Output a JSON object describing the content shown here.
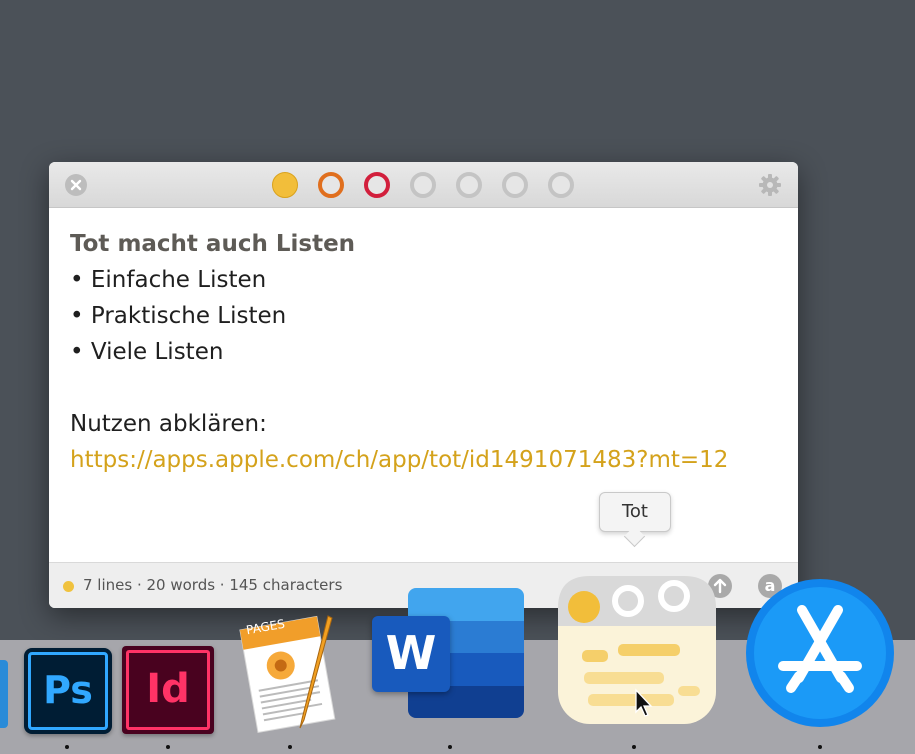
{
  "popover": {
    "title_bar": {
      "close_icon": "close-icon",
      "color_dots": [
        {
          "name": "yellow",
          "color": "#f2be3a",
          "filled": true
        },
        {
          "name": "orange",
          "color": "#e06f1e",
          "filled": false
        },
        {
          "name": "red",
          "color": "#d21f3c",
          "filled": false
        },
        {
          "name": "gray-1",
          "color": "#c4c4c4",
          "filled": false
        },
        {
          "name": "gray-2",
          "color": "#c4c4c4",
          "filled": false
        },
        {
          "name": "gray-3",
          "color": "#c4c4c4",
          "filled": false
        },
        {
          "name": "gray-4",
          "color": "#c4c4c4",
          "filled": false
        }
      ],
      "settings_icon": "gear-icon"
    },
    "note": {
      "title": "Tot macht auch Listen",
      "bullets": [
        "• Einfache Listen",
        "• Praktische Listen",
        "• Viele Listen"
      ],
      "body_label": "Nutzen abklären:",
      "link": "https://apps.apple.com/ch/app/tot/id1491071483?mt=12"
    },
    "status": {
      "dot_color": "#f0c23e",
      "text": "7 lines · 20 words · 145 characters",
      "share_icon": "share-up-arrow-icon",
      "format_icon": "at-sign-icon"
    }
  },
  "tooltip": {
    "text": "Tot"
  },
  "dock": {
    "apps": [
      {
        "name": "Photoshop",
        "label": "Ps"
      },
      {
        "name": "InDesign",
        "label": "Id"
      },
      {
        "name": "Pages",
        "label": "PAGES"
      },
      {
        "name": "Word",
        "label": "W"
      },
      {
        "name": "Tot",
        "label": ""
      },
      {
        "name": "App Store",
        "label": ""
      }
    ]
  }
}
